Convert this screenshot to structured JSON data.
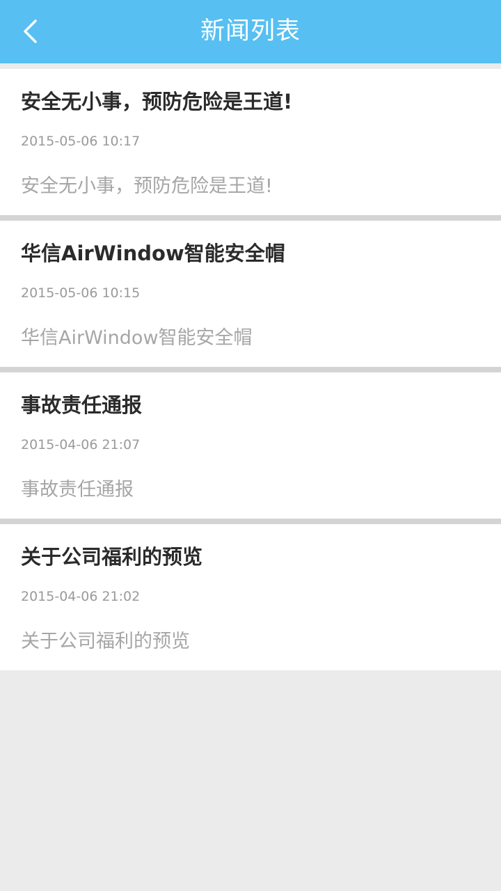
{
  "header": {
    "title": "新闻列表",
    "back_icon": "chevron-left-icon",
    "background_color": "#57bff2"
  },
  "news": [
    {
      "title": "安全无小事，预防危险是王道!",
      "time": "2015-05-06 10:17",
      "summary": "安全无小事，预防危险是王道!"
    },
    {
      "title": "华信AirWindow智能安全帽",
      "time": "2015-05-06 10:15",
      "summary": "华信AirWindow智能安全帽"
    },
    {
      "title": "事故责任通报",
      "time": "2015-04-06 21:07",
      "summary": "事故责任通报"
    },
    {
      "title": "关于公司福利的预览",
      "time": "2015-04-06 21:02",
      "summary": "关于公司福利的预览"
    }
  ]
}
